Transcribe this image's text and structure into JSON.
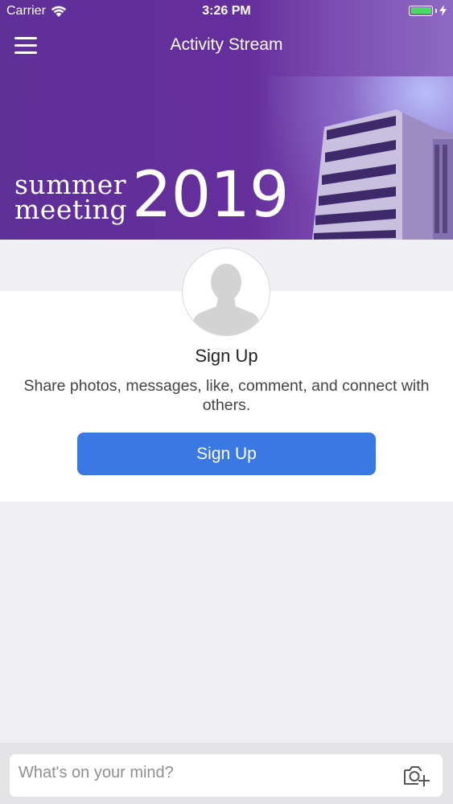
{
  "status_bar": {
    "carrier": "Carrier",
    "time": "3:26 PM",
    "battery_color": "#4cd964"
  },
  "nav": {
    "title": "Activity Stream",
    "menu_icon": "hamburger-menu-icon"
  },
  "banner": {
    "word_1": "summer",
    "word_2": "meeting",
    "year": "2019",
    "background_color": "#652f9c"
  },
  "signup_card": {
    "avatar_icon": "default-avatar-icon",
    "title": "Sign Up",
    "description": "Share photos, messages, like, comment, and connect with others.",
    "button_label": "Sign Up",
    "button_color": "#3a78e4"
  },
  "composer": {
    "placeholder": "What's on your mind?",
    "camera_icon": "add-photo-camera-icon"
  }
}
